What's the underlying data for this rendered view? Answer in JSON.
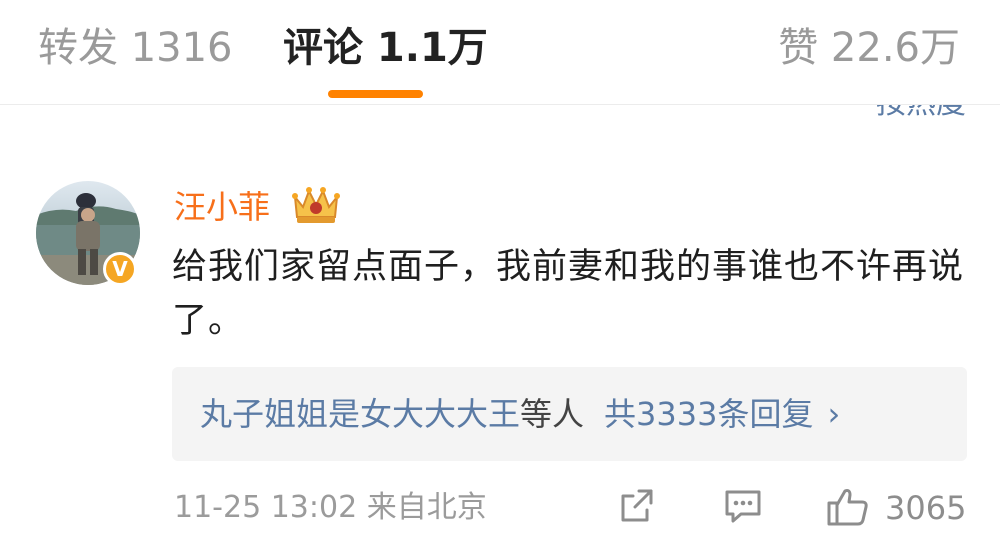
{
  "tabs": {
    "repost": "转发 1316",
    "comments": "评论 1.1万",
    "likes": "赞 22.6万"
  },
  "sort": {
    "label": "按热度"
  },
  "comment": {
    "username": "汪小菲",
    "text": "给我们家留点面子，我前妻和我的事谁也不许再说了。",
    "verified_mark": "V",
    "replies": {
      "users": "丸子姐姐是女大大大王",
      "etc": "等人",
      "count": "共3333条回复",
      "chevron": "›"
    },
    "timestamp": "11-25 13:02",
    "location": "来自北京",
    "like_count": "3065"
  },
  "icons": {
    "crown": "crown-badge-icon",
    "share": "share-icon",
    "comment": "comment-icon",
    "like": "thumbs-up-icon"
  },
  "colors": {
    "accent": "#ff8200",
    "username": "#f76f1a",
    "link": "#5b7ba5"
  }
}
